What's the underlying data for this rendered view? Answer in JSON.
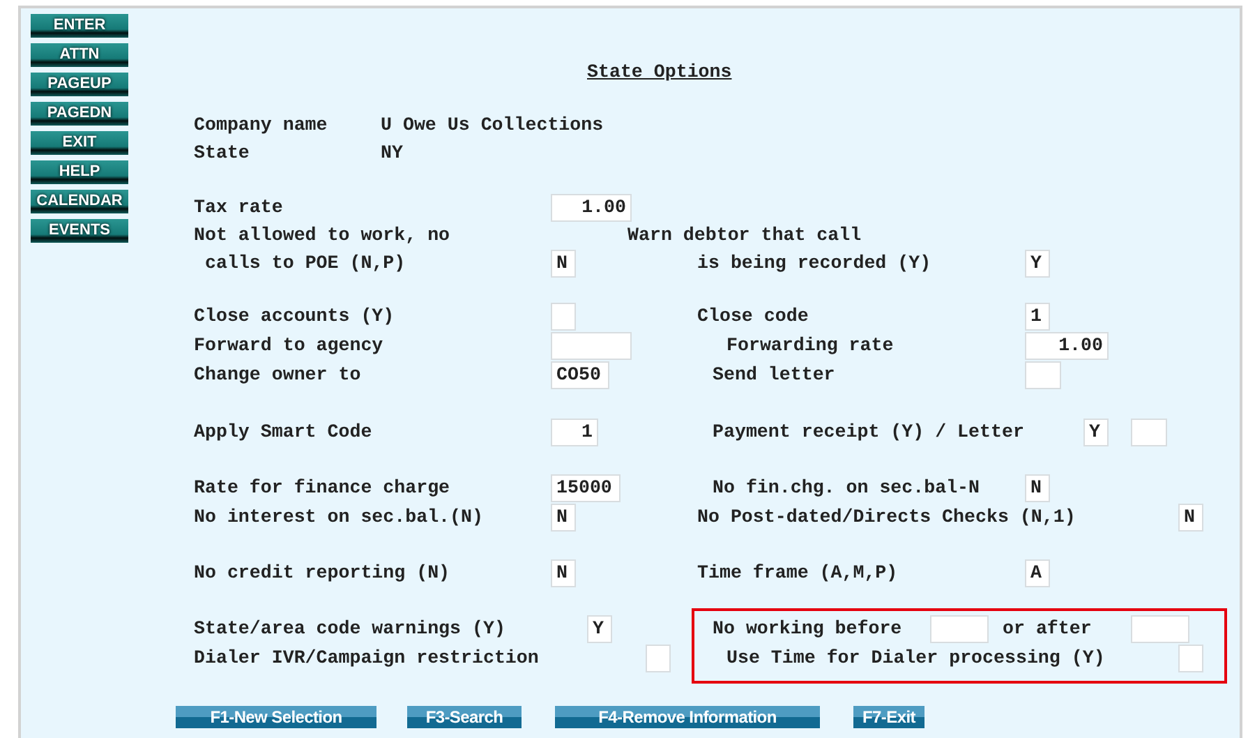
{
  "sidebar": {
    "buttons": [
      "ENTER",
      "ATTN",
      "PAGEUP",
      "PAGEDN",
      "EXIT",
      "HELP",
      "CALENDAR",
      "EVENTS"
    ]
  },
  "title": "State Options",
  "company": {
    "label": "Company name",
    "value": "U Owe Us Collections"
  },
  "state": {
    "label": "State",
    "value": "NY"
  },
  "tax_rate": {
    "label": "Tax rate",
    "value": "1.00"
  },
  "not_allowed": {
    "label_lines": [
      "Not allowed to work, no",
      "calls to POE (N,P)"
    ],
    "value": "N"
  },
  "warn_debtor": {
    "label_lines": [
      "Warn debtor that call",
      "is being recorded (Y)"
    ],
    "value": "Y"
  },
  "close_accounts": {
    "label": "Close accounts (Y)"
  },
  "close_code": {
    "label": "Close code",
    "value": "1"
  },
  "forward_to_agency": {
    "label": "Forward to agency"
  },
  "forwarding_rate": {
    "label": "Forwarding rate",
    "value": "1.00"
  },
  "change_owner": {
    "label": "Change owner to",
    "value": "CO50"
  },
  "send_letter": {
    "label": "Send letter"
  },
  "apply_smart_code": {
    "label": "Apply Smart Code",
    "value": "1"
  },
  "payment_receipt": {
    "label": "Payment receipt (Y) / Letter",
    "value": "Y"
  },
  "finance_charge_rate": {
    "label": "Rate for finance charge",
    "value": "15000"
  },
  "no_fin_chg": {
    "label": "No fin.chg. on sec.bal-N",
    "value": "N"
  },
  "no_interest": {
    "label": "No interest on sec.bal.(N)",
    "value": "N"
  },
  "no_post_dated": {
    "label": "No Post-dated/Directs Checks (N,1)",
    "value": "N"
  },
  "no_credit_reporting": {
    "label": "No credit reporting (N)",
    "value": "N"
  },
  "time_frame": {
    "label": "Time frame (A,M,P)",
    "value": "A"
  },
  "area_code_warnings": {
    "label": "State/area code warnings (Y)",
    "value": "Y"
  },
  "dialer_restriction": {
    "label": "Dialer IVR/Campaign restriction"
  },
  "dialer_time": {
    "highlighted": true,
    "before_label": "No working before",
    "after_label": "or after",
    "use_time_label": "Use Time for Dialer processing (Y)"
  },
  "function_keys": [
    "F1-New Selection",
    "F3-Search",
    "F4-Remove Information",
    "F7-Exit"
  ]
}
